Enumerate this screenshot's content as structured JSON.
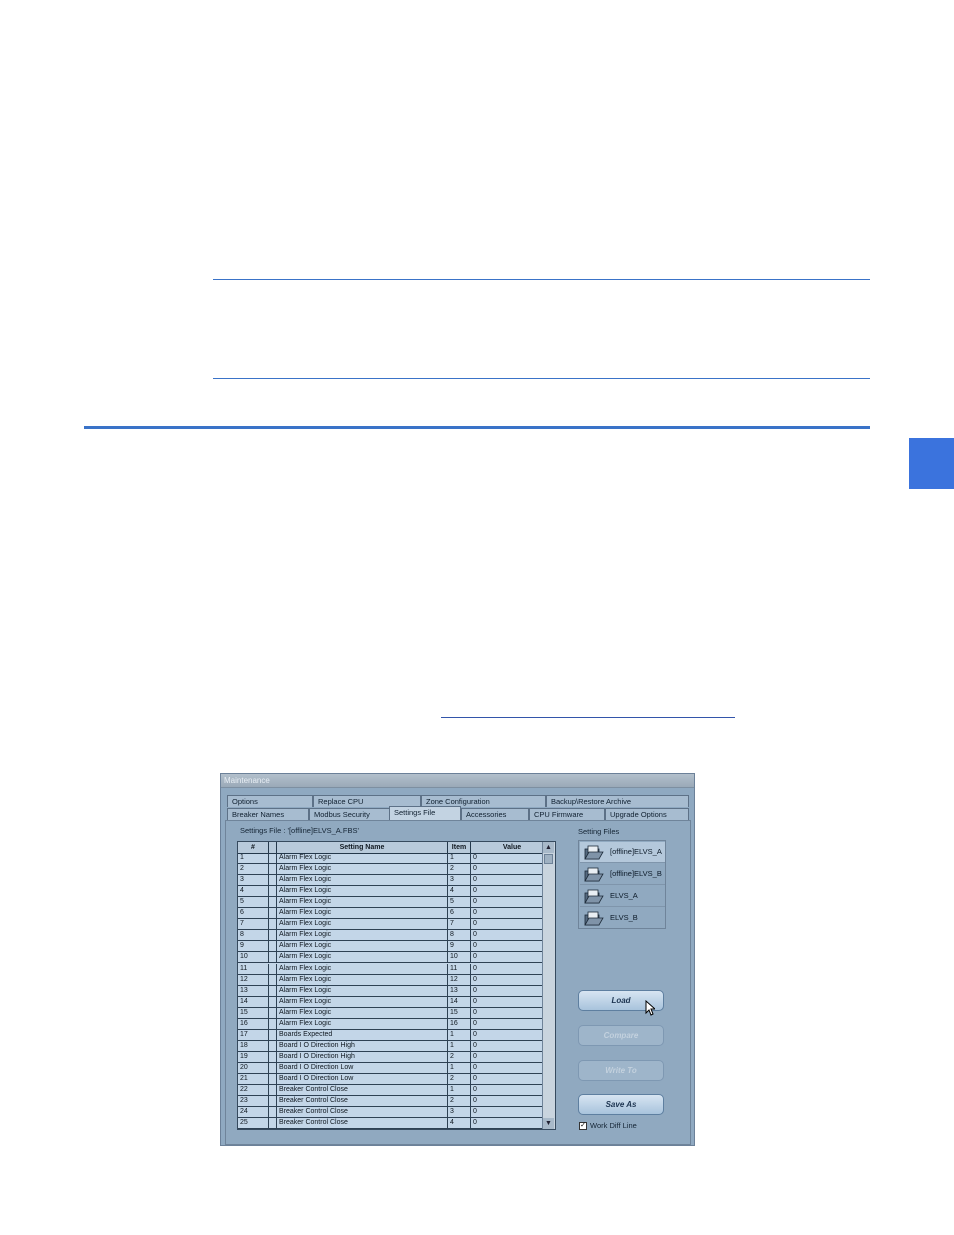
{
  "window": {
    "title": "Maintenance",
    "tabs_row1": [
      "Options",
      "Replace CPU",
      "Zone Configuration",
      "Backup\\Restore Archive"
    ],
    "tabs_row2": [
      "Breaker Names",
      "Modbus Security",
      "Settings File",
      "Accessories",
      "CPU Firmware",
      "Upgrade Options"
    ],
    "active_tab": "Settings File",
    "settings_file_label": "Settings File : '[offline]ELVS_A.FBS'",
    "setting_files_label": "Setting Files",
    "grid": {
      "columns": [
        "#",
        "",
        "Setting Name",
        "Item",
        "Value"
      ],
      "rows": [
        {
          "num": "1",
          "name": "Alarm Flex Logic",
          "item": "1",
          "value": "0"
        },
        {
          "num": "2",
          "name": "Alarm Flex Logic",
          "item": "2",
          "value": "0"
        },
        {
          "num": "3",
          "name": "Alarm Flex Logic",
          "item": "3",
          "value": "0"
        },
        {
          "num": "4",
          "name": "Alarm Flex Logic",
          "item": "4",
          "value": "0"
        },
        {
          "num": "5",
          "name": "Alarm Flex Logic",
          "item": "5",
          "value": "0"
        },
        {
          "num": "6",
          "name": "Alarm Flex Logic",
          "item": "6",
          "value": "0"
        },
        {
          "num": "7",
          "name": "Alarm Flex Logic",
          "item": "7",
          "value": "0"
        },
        {
          "num": "8",
          "name": "Alarm Flex Logic",
          "item": "8",
          "value": "0"
        },
        {
          "num": "9",
          "name": "Alarm Flex Logic",
          "item": "9",
          "value": "0"
        },
        {
          "num": "10",
          "name": "Alarm Flex Logic",
          "item": "10",
          "value": "0"
        },
        {
          "num": "11",
          "name": "Alarm Flex Logic",
          "item": "11",
          "value": "0"
        },
        {
          "num": "12",
          "name": "Alarm Flex Logic",
          "item": "12",
          "value": "0"
        },
        {
          "num": "13",
          "name": "Alarm Flex Logic",
          "item": "13",
          "value": "0"
        },
        {
          "num": "14",
          "name": "Alarm Flex Logic",
          "item": "14",
          "value": "0"
        },
        {
          "num": "15",
          "name": "Alarm Flex Logic",
          "item": "15",
          "value": "0"
        },
        {
          "num": "16",
          "name": "Alarm Flex Logic",
          "item": "16",
          "value": "0"
        },
        {
          "num": "17",
          "name": "Boards Expected",
          "item": "1",
          "value": "0"
        },
        {
          "num": "18",
          "name": "Board I O Direction High",
          "item": "1",
          "value": "0"
        },
        {
          "num": "19",
          "name": "Board I O Direction High",
          "item": "2",
          "value": "0"
        },
        {
          "num": "20",
          "name": "Board I O Direction Low",
          "item": "1",
          "value": "0"
        },
        {
          "num": "21",
          "name": "Board I O Direction Low",
          "item": "2",
          "value": "0"
        },
        {
          "num": "22",
          "name": "Breaker Control Close",
          "item": "1",
          "value": "0"
        },
        {
          "num": "23",
          "name": "Breaker Control Close",
          "item": "2",
          "value": "0"
        },
        {
          "num": "24",
          "name": "Breaker Control Close",
          "item": "3",
          "value": "0"
        },
        {
          "num": "25",
          "name": "Breaker Control Close",
          "item": "4",
          "value": "0"
        }
      ]
    },
    "files": [
      {
        "name": "[offline]ELVS_A",
        "selected": true
      },
      {
        "name": "[offline]ELVS_B",
        "selected": false
      },
      {
        "name": "ELVS_A",
        "selected": false
      },
      {
        "name": "ELVS_B",
        "selected": false
      }
    ],
    "buttons": {
      "load": "Load",
      "compare": "Compare",
      "write_to": "Write To",
      "save_as": "Save As"
    },
    "checkbox": {
      "label": "Work Diff Line",
      "checked": true,
      "mark": "✓"
    },
    "scroll": {
      "up": "▲",
      "down": "▼"
    }
  },
  "colors": {
    "rule": "#3a73c8",
    "side_tab": "#3b73dd"
  }
}
